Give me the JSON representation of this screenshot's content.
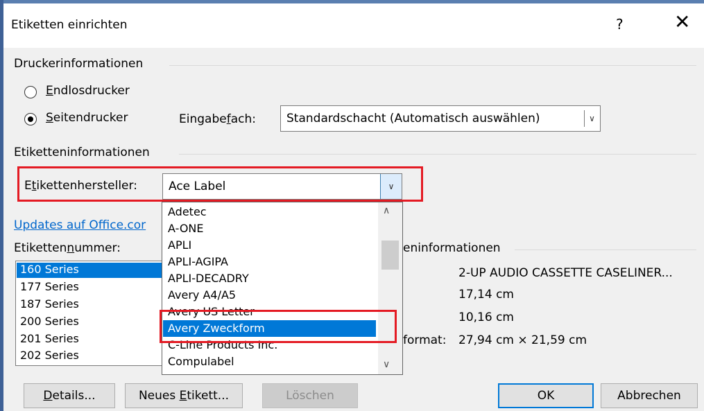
{
  "window": {
    "title": "Etiketten einrichten",
    "help_glyph": "?",
    "close_glyph": "✕"
  },
  "printer_info": {
    "section_label": "Druckerinformationen",
    "continuous": {
      "pre": "",
      "acc": "E",
      "post": "ndlosdrucker",
      "checked": false
    },
    "page_printer": {
      "pre": "",
      "acc": "S",
      "post": "eitendrucker",
      "checked": true
    },
    "tray_label": {
      "pre": "Eingabe",
      "acc": "f",
      "post": "ach:"
    },
    "tray_value": "Standardschacht (Automatisch auswählen)"
  },
  "label_info": {
    "section_label": "Etiketteninformationen",
    "vendor_label": {
      "pre": "E",
      "acc": "t",
      "post": "ikettenhersteller:"
    },
    "vendor_value": "Ace Label",
    "vendor_options": [
      "Adetec",
      "A-ONE",
      "APLI",
      "APLI-AGIPA",
      "APLI-DECADRY",
      "Avery A4/A5",
      "Avery US Letter",
      "Avery Zweckform",
      "C-Line Products Inc.",
      "Compulabel"
    ],
    "highlighted_option": "Avery Zweckform",
    "updates_link": "Updates auf Office.cor"
  },
  "product": {
    "number_label": {
      "pre": "Etiketten",
      "acc": "n",
      "post": "ummer:"
    },
    "numbers": [
      "160 Series",
      "177 Series",
      "187 Series",
      "200 Series",
      "201 Series",
      "202 Series"
    ],
    "selected": "160 Series"
  },
  "details": {
    "section_label_partial": "eninformationen",
    "type_value": "2-UP AUDIO CASSETTE CASELINER...",
    "height_value": "17,14 cm",
    "width_value": "10,16 cm",
    "format_label_partial": "format:",
    "format_value": "27,94 cm × 21,59 cm"
  },
  "buttons": {
    "details": {
      "acc": "D",
      "post": "etails..."
    },
    "new_label": {
      "pre": "Neues ",
      "acc": "E",
      "post": "tikett..."
    },
    "delete": "Löschen",
    "ok": "OK",
    "cancel": "Abbrechen"
  },
  "colors": {
    "highlight_red": "#e41a23",
    "selection_blue": "#0078d7",
    "link_blue": "#0066cc",
    "dialog_bg": "#f0f0f0"
  }
}
